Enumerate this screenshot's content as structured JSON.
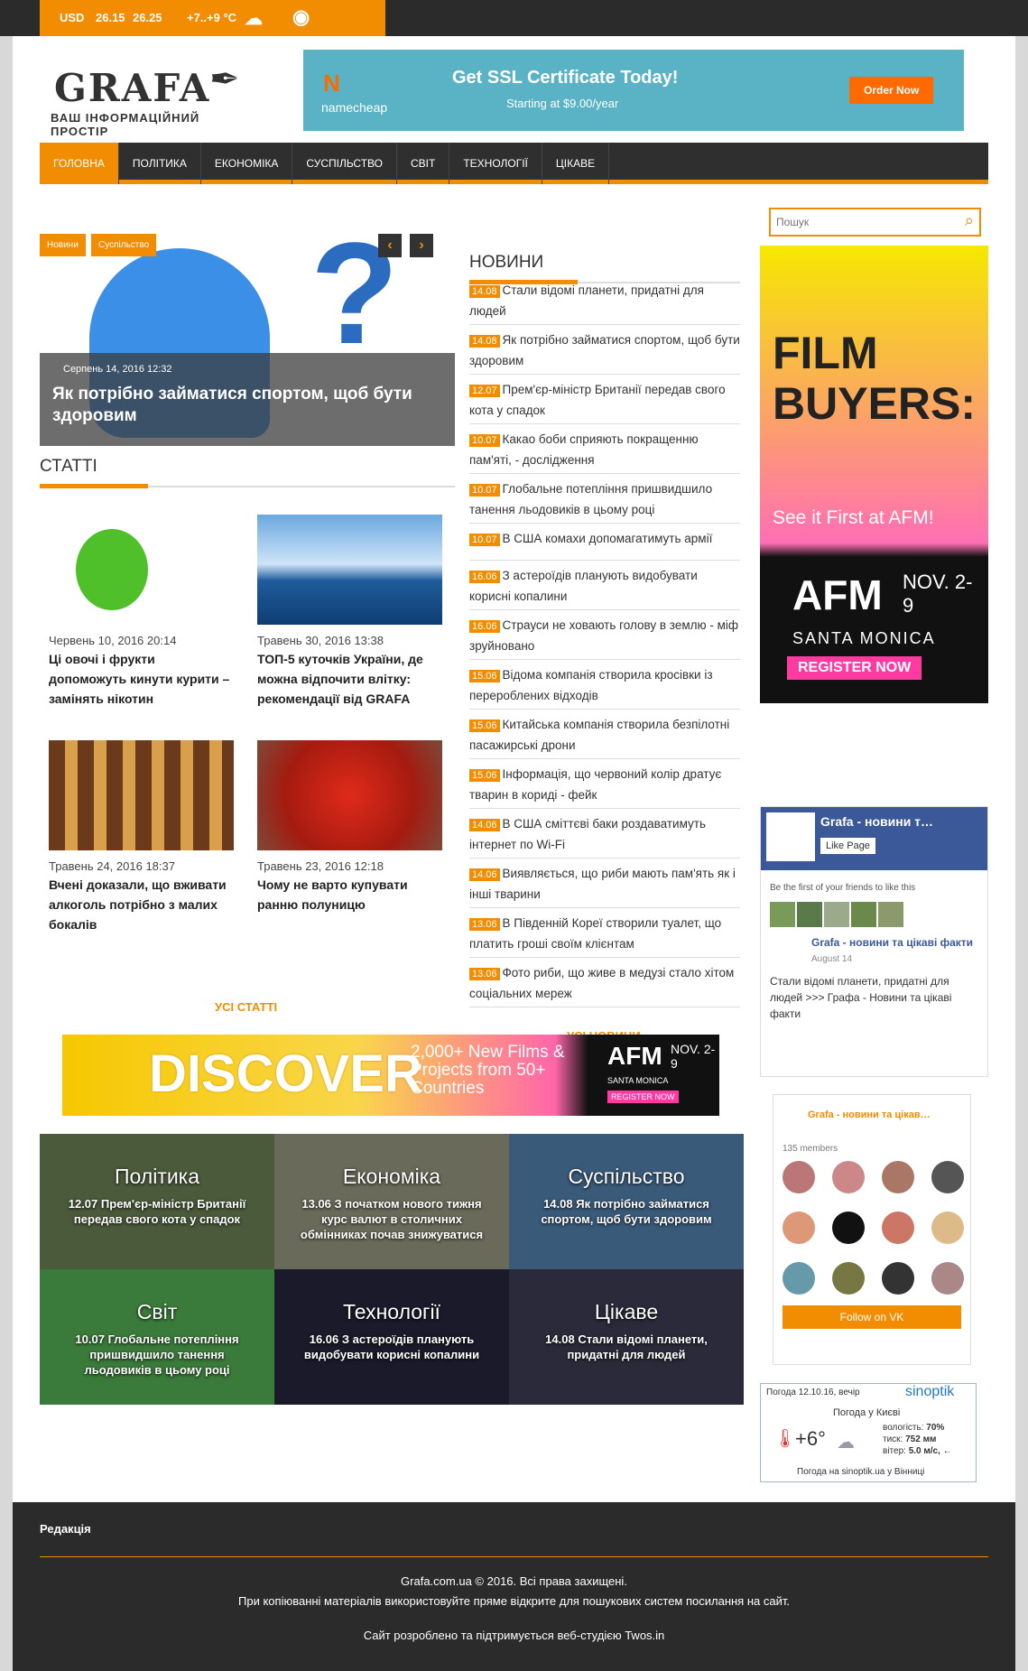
{
  "topbar": {
    "currency_label": "USD",
    "rate_buy": "26.15",
    "rate_sell": "26.25",
    "temp": "+7..+9 °C"
  },
  "logo": {
    "name": "GRAFA",
    "tagline": "ВАШ ІНФОРМАЦІЙНИЙ ПРОСТІР"
  },
  "ad_top": {
    "brand": "namecheap",
    "headline": "Get SSL Certificate Today!",
    "sub": "Starting at $9.00/year",
    "cta": "Order Now"
  },
  "nav": [
    "ГОЛОВНА",
    "ПОЛІТИКА",
    "ЕКОНОМІКА",
    "СУСПІЛЬСТВО",
    "СВІТ",
    "ТЕХНОЛОГІЇ",
    "ЦІКАВЕ"
  ],
  "slider": {
    "tag1": "Новини",
    "tag2": "Суспільство",
    "date": "Серпень 14, 2016 12:32",
    "title": "Як потрібно займатися спортом, щоб бути здоровим"
  },
  "articles_title": "СТАТТІ",
  "articles": [
    {
      "date": "Червень 10, 2016 20:14",
      "title": "Ці овочі і фрукти допоможуть кинути курити – замінять нікотин"
    },
    {
      "date": "Травень 30, 2016 13:38",
      "title": "ТОП-5 куточків України, де можна відпочити влітку: рекомендації від GRAFA"
    },
    {
      "date": "Травень 24, 2016 18:37",
      "title": "Вчені доказали, що вживати алкоголь потрібно з малих бокалів"
    },
    {
      "date": "Травень 23, 2016 12:18",
      "title": "Чому не варто купувати ранню полуницю"
    }
  ],
  "all_articles": "УСІ СТАТТІ",
  "news_title": "НОВИНИ",
  "news": [
    {
      "d": "14.08",
      "t": "Стали відомі планети, придатні для людей"
    },
    {
      "d": "14.08",
      "t": "Як потрібно займатися спортом, щоб бути здоровим"
    },
    {
      "d": "12.07",
      "t": "Прем'єр-міністр Британії передав свого кота у спадок"
    },
    {
      "d": "10.07",
      "t": "Какао боби сприяють покращенню пам'яті, - дослідження"
    },
    {
      "d": "10.07",
      "t": "Глобальне потепління пришвидшило танення льодовиків в цьому році"
    },
    {
      "d": "10.07",
      "t": "В США комахи допомагатимуть армії"
    },
    {
      "d": "16.06",
      "t": "З астероїдів планують видобувати корисні копалини"
    },
    {
      "d": "16.06",
      "t": "Страуси не ховають голову в землю - міф зруйновано"
    },
    {
      "d": "15.06",
      "t": "Відома компанія створила кросівки із перероблених відходів"
    },
    {
      "d": "15.06",
      "t": "Китайська компанія створила безпілотні пасажирські дрони"
    },
    {
      "d": "15.06",
      "t": "Інформація, що червоний колір дратує тварин в кориді - фейк"
    },
    {
      "d": "14.06",
      "t": "В США сміттєві баки роздаватимуть інтернет по Wi-Fi"
    },
    {
      "d": "14.06",
      "t": "Виявляється, що риби мають пам'ять як і інші тварини"
    },
    {
      "d": "13.06",
      "t": "В Південній Кореї створили туалет, що платить гроші своїм клієнтам"
    },
    {
      "d": "13.06",
      "t": "Фото риби, що живе в медузі стало хітом соціальних мереж"
    }
  ],
  "all_news": "УСІ НОВИНИ",
  "search_placeholder": "Пошук",
  "ad_side": {
    "l1": "FILM",
    "l2": "BUYERS:",
    "l3": "See it First at AFM!",
    "brand": "AFM",
    "dates": "NOV. 2-9",
    "city": "SANTA MONICA",
    "cta": "REGISTER NOW"
  },
  "ad_mid": {
    "word": "DISCOVER",
    "sub": "2,000+ New Films & Projects from 50+ Countries",
    "brand": "AFM",
    "dates": "NOV. 2-9",
    "city": "SANTA MONICA",
    "cta": "REGISTER NOW"
  },
  "categories": [
    {
      "name": "Політика",
      "d": "12.07",
      "t": "Прем'єр-міністр Британії передав свого кота у спадок",
      "bg": "#4a5a3a"
    },
    {
      "name": "Економіка",
      "d": "13.06",
      "t": "З початком нового тижня курс валют в столичних обмінниках почав знижуватися",
      "bg": "#6a6a5a"
    },
    {
      "name": "Суспільство",
      "d": "14.08",
      "t": "Як потрібно займатися спортом, щоб бути здоровим",
      "bg": "#3a5a7a"
    },
    {
      "name": "Світ",
      "d": "10.07",
      "t": "Глобальне потепління пришвидшило танення льодовиків в цьому році",
      "bg": "#3a7a3a"
    },
    {
      "name": "Технології",
      "d": "16.06",
      "t": "З астероїдів планують видобувати корисні копалини",
      "bg": "#1a1a2a"
    },
    {
      "name": "Цікаве",
      "d": "14.08",
      "t": "Стали відомі планети, придатні для людей",
      "bg": "#2a2a3a"
    }
  ],
  "fb": {
    "page": "Grafa - новини т…",
    "like": "Like Page",
    "friends": "Be the first of your friends to like this",
    "post_author": "Grafa - новини та цікаві факти",
    "post_date": "August 14",
    "post_text": "Стали відомі планети, придатні для людей >>> Графа - Новини та цікаві факти"
  },
  "vk": {
    "group": "Grafa - новини та цікав…",
    "members": "135 members",
    "follow": "Follow on VK"
  },
  "weather": {
    "head": "Погода 12.10.16, вечір",
    "brand": "sinoptik",
    "city": "Погода у Києві",
    "temp": "+6°",
    "humidity_l": "вологість:",
    "humidity": "70%",
    "pressure_l": "тиск:",
    "pressure": "752 мм",
    "wind_l": "вітер:",
    "wind": "5.0 м/с, ←",
    "foot": "Погода на sinoptik.ua у Вінниці"
  },
  "footer": {
    "editorial": "Редакція",
    "copyright": "Grafa.com.ua © 2016. Всі права захищені.",
    "notice": "При копіюванні матеріалів використовуйте пряме відкрите для пошукових систем посилання на сайт.",
    "dev": "Сайт розроблено та підтримується веб-студією Twos.in"
  }
}
